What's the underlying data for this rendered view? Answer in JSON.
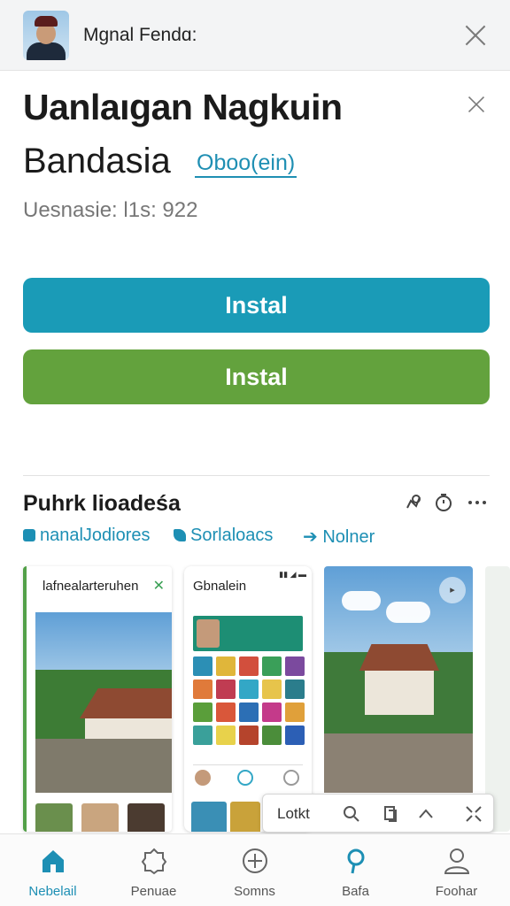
{
  "topbar": {
    "name": "Mgnal Fendɑ:"
  },
  "heading": {
    "title": "Uanlaıgan Nagkuin",
    "subtitle": "Bandasia",
    "sublink": "Oboo(ein)",
    "version": "Uesnasie: l1s: 922"
  },
  "buttons": {
    "primary": "Instal",
    "secondary": "Instal"
  },
  "section": {
    "title": "Puhrk lioadeśa",
    "chips": [
      "nanalJodiores",
      "Sorlaloacs",
      "Nolner"
    ]
  },
  "cards": [
    {
      "label": "lafnealarteruhen"
    },
    {
      "label": "Gbnalein"
    }
  ],
  "float_bar": {
    "label": "Lotkt"
  },
  "nav": [
    {
      "label": "Nebelail",
      "icon": "home-icon",
      "active": true
    },
    {
      "label": "Penuae",
      "icon": "badge-icon",
      "active": false
    },
    {
      "label": "Somns",
      "icon": "plus-circle-icon",
      "active": false
    },
    {
      "label": "Bafa",
      "icon": "location-pin-icon",
      "active": false
    },
    {
      "label": "Foohar",
      "icon": "profile-icon",
      "active": false
    }
  ],
  "colors": {
    "accent": "#1a9bb7",
    "green": "#63a23d"
  }
}
